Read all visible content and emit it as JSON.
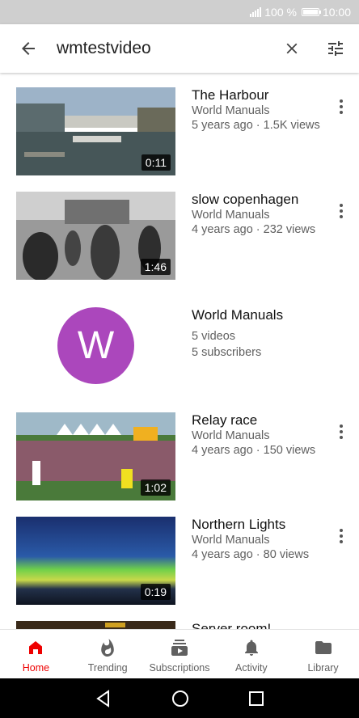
{
  "status": {
    "battery": "100 %",
    "time": "10:00"
  },
  "search": {
    "query": "wmtestvideo"
  },
  "results": [
    {
      "type": "video",
      "title": "The Harbour",
      "channel": "World Manuals",
      "meta": "5 years ago · 1.5K views",
      "duration": "0:11"
    },
    {
      "type": "video",
      "title": "slow copenhagen",
      "channel": "World Manuals",
      "meta": "4 years ago · 232 views",
      "duration": "1:46"
    },
    {
      "type": "channel",
      "name": "World Manuals",
      "initial": "W",
      "videos": "5 videos",
      "subscribers": "5 subscribers"
    },
    {
      "type": "video",
      "title": "Relay race",
      "channel": "World Manuals",
      "meta": "4 years ago · 150 views",
      "duration": "1:02"
    },
    {
      "type": "video",
      "title": "Northern Lights",
      "channel": "World Manuals",
      "meta": "4 years ago · 80 views",
      "duration": "0:19"
    },
    {
      "type": "video",
      "title": "Server room!"
    }
  ],
  "nav": [
    {
      "label": "Home",
      "icon": "home-icon",
      "active": true
    },
    {
      "label": "Trending",
      "icon": "flame-icon"
    },
    {
      "label": "Subscriptions",
      "icon": "subscriptions-icon"
    },
    {
      "label": "Activity",
      "icon": "bell-icon"
    },
    {
      "label": "Library",
      "icon": "folder-icon"
    }
  ],
  "colors": {
    "accent": "#ee0000",
    "avatar": "#ab47bc"
  }
}
